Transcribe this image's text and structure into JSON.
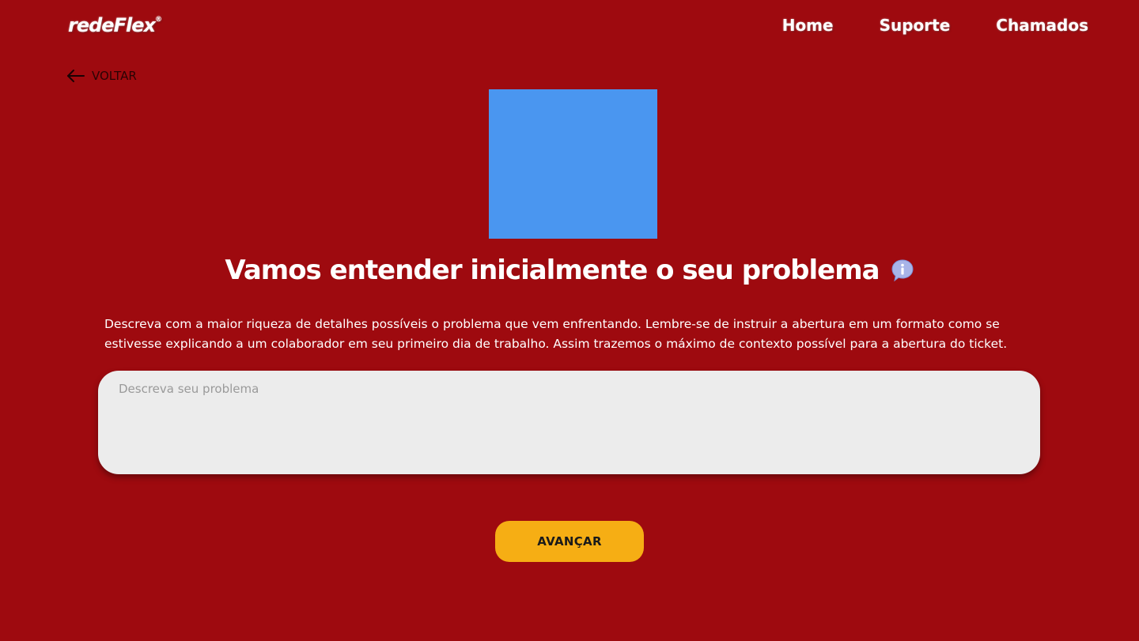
{
  "header": {
    "logo_text": "redeFlex",
    "logo_mark": "®",
    "nav": {
      "home": "Home",
      "support": "Suporte",
      "tickets": "Chamados"
    }
  },
  "back": {
    "label": "VOLTAR",
    "icon": "arrow-left-icon"
  },
  "main": {
    "title": "Vamos entender inicialmente o seu problema",
    "title_icon": "info-speech-bubble-icon",
    "description": "Descreva com a maior riqueza de detalhes possíveis o problema que vem enfrentando. Lembre-se de instruir a abertura em um formato como se estivesse explicando a um colaborador em seu primeiro dia de trabalho. Assim trazemos o máximo de contexto possível para a abertura do ticket.",
    "problem_placeholder": "Descreva seu problema",
    "problem_value": "",
    "advance_label": "AVANÇAR"
  },
  "colors": {
    "background": "#9e0a0f",
    "image_placeholder": "#4a96f0",
    "input_background": "#ececec",
    "button": "#f6ae14"
  }
}
